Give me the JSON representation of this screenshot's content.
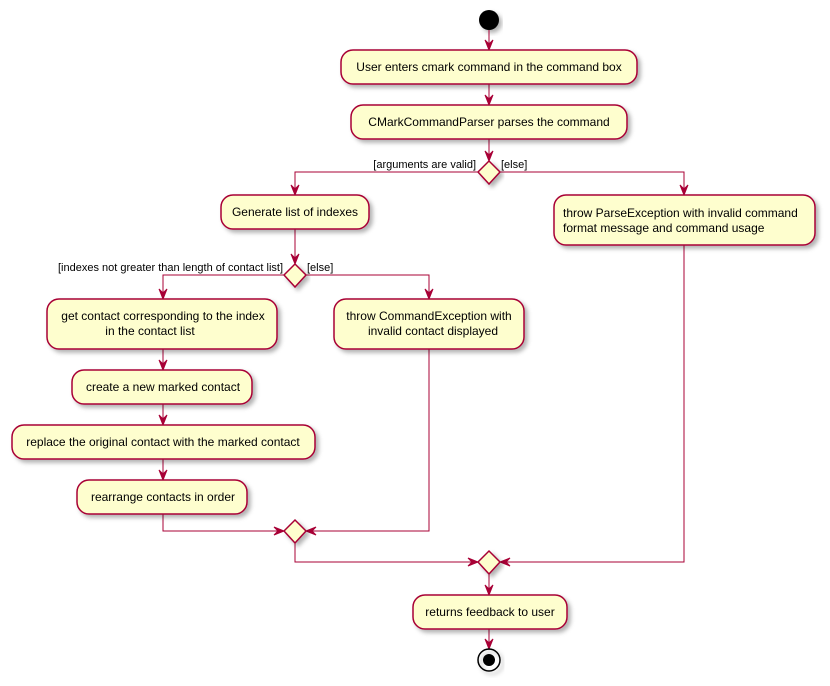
{
  "colors": {
    "border": "#A80036",
    "fill": "#FEFECE",
    "start_end": "#000000"
  },
  "actions": {
    "enter_command": [
      "User enters cmark command in the command box"
    ],
    "parse_command": [
      "CMarkCommandParser parses the command"
    ],
    "generate_indexes": [
      "Generate list of indexes"
    ],
    "throw_parse_exception": [
      "throw ParseException with invalid command",
      "format message and command usage"
    ],
    "get_contact": [
      "get contact corresponding to the index",
      "in the contact list"
    ],
    "throw_command_exception": [
      "throw CommandException with",
      "invalid contact displayed"
    ],
    "create_marked": [
      "create a new marked contact"
    ],
    "replace_contact": [
      "replace the original contact with the marked contact"
    ],
    "rearrange": [
      "rearrange contacts in order"
    ],
    "feedback": [
      "returns feedback to user"
    ]
  },
  "guards": {
    "args_valid": "[arguments are valid]",
    "args_else": "[else]",
    "indexes_valid": "[indexes not greater than length of contact list]",
    "indexes_else": "[else]"
  }
}
